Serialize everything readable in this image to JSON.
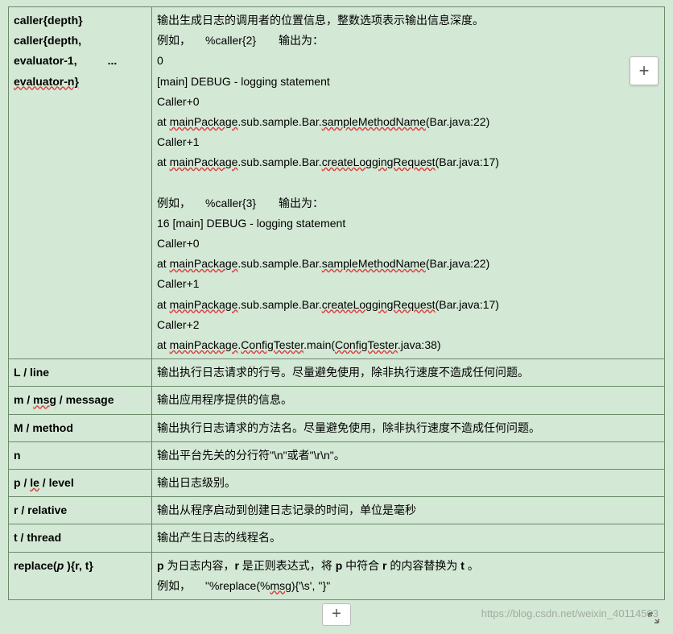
{
  "rows": [
    {
      "key": "caller",
      "labelParts": [
        "caller{depth}",
        "caller{depth,",
        "evaluator-1,",
        "evaluator-n}"
      ],
      "desc": {
        "line1_a": "输出生成日志的调用者的位置信息，整数选项表示输出信息深度。",
        "line2_a": "例如，",
        "line2_b": "%caller{2}",
        "line2_c": "输出为：",
        "line3": "0",
        "line4": "[main] DEBUG - logging statement",
        "line5": "Caller+0",
        "line6_a": "at ",
        "line6_b": "mainPackage",
        "line6_c": ".sub.sample.Bar.",
        "line6_d": "sampleMethodName",
        "line6_e": "(Bar.java:22)",
        "line7": "Caller+1",
        "line8_a": "at ",
        "line8_b": "mainPackage",
        "line8_c": ".sub.sample.Bar.",
        "line8_d": "createLoggingRequest",
        "line8_e": "(Bar.java:17)",
        "line9": "",
        "line10_a": "例如，",
        "line10_b": "%caller{3}",
        "line10_c": "输出为：",
        "line11": "16       [main] DEBUG - logging statement",
        "line12": "Caller+0",
        "line13_a": "at ",
        "line13_b": "mainPackage",
        "line13_c": ".sub.sample.Bar.",
        "line13_d": "sampleMethodName",
        "line13_e": "(Bar.java:22)",
        "line14": "Caller+1",
        "line15_a": "at ",
        "line15_b": "mainPackage",
        "line15_c": ".sub.sample.Bar.",
        "line15_d": "createLoggingRequest",
        "line15_e": "(Bar.java:17)",
        "line16": "Caller+2",
        "line17_a": "at ",
        "line17_b": "mainPackage",
        "line17_c": ".",
        "line17_d": "ConfigTester",
        "line17_e": ".main(",
        "line17_f": "ConfigTester",
        "line17_g": ".java:38)"
      }
    },
    {
      "key": "L-line",
      "labelParts": [
        "L / line"
      ],
      "simpleDesc": "输出执行日志请求的行号。尽量避免使用，除非执行速度不造成任何问题。"
    },
    {
      "key": "m-msg-message",
      "labelParts": [
        "m / ",
        "msg",
        " / message"
      ],
      "underlined": [
        1
      ],
      "simpleDesc": "输出应用程序提供的信息。"
    },
    {
      "key": "M-method",
      "labelParts": [
        "M / method"
      ],
      "simpleDesc": "输出执行日志请求的方法名。尽量避免使用，除非执行速度不造成任何问题。"
    },
    {
      "key": "n",
      "labelParts": [
        "n"
      ],
      "simpleDesc": "输出平台先关的分行符\"\\n\"或者\"\\r\\n\"。"
    },
    {
      "key": "p-le-level",
      "labelParts": [
        "p / ",
        "le",
        " / level"
      ],
      "underlined": [
        1
      ],
      "simpleDesc": "输出日志级别。"
    },
    {
      "key": "r-relative",
      "labelParts": [
        "r / relative"
      ],
      "simpleDesc": "输出从程序启动到创建日志记录的时间，单位是毫秒"
    },
    {
      "key": "t-thread",
      "labelParts": [
        "t / thread"
      ],
      "simpleDesc": "输出产生日志的线程名。"
    },
    {
      "key": "replace",
      "labelParts": [
        "replace(",
        "p ",
        "){r, t}"
      ],
      "italicMid": true,
      "desc2": {
        "l1_a": "p",
        "l1_b": " 为日志内容，",
        "l1_c": "r",
        "l1_d": " 是正则表达式，将 ",
        "l1_e": "p",
        "l1_f": " 中符合 ",
        "l1_g": "r",
        "l1_h": " 的内容替换为 ",
        "l1_i": "t",
        "l1_j": " 。",
        "l2_a": "例如，",
        "l2_b": "\"%replace(%",
        "l2_c": "msg",
        "l2_d": "){'\\s', ''}\""
      }
    }
  ],
  "watermark": "https://blog.csdn.net/weixin_40114503",
  "plus": "+",
  "ellipsis": "..."
}
